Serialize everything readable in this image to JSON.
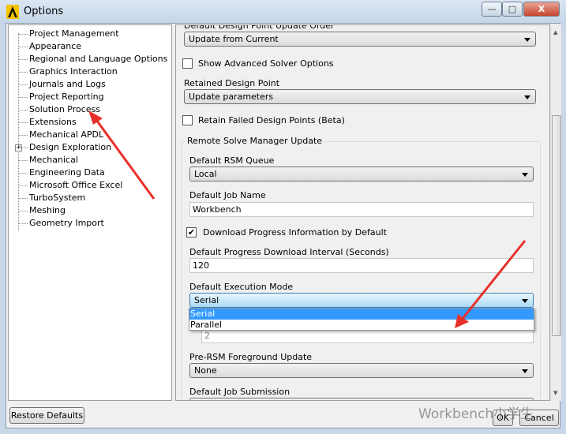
{
  "window": {
    "title": "Options",
    "minimize": "—",
    "maximize": "□",
    "close": "X"
  },
  "tree": {
    "items": [
      "Project Management",
      "Appearance",
      "Regional and Language Options",
      "Graphics Interaction",
      "Journals and Logs",
      "Project Reporting",
      "Solution Process",
      "Extensions",
      "Mechanical APDL",
      "Design Exploration",
      "Mechanical",
      "Engineering Data",
      "Microsoft Office Excel",
      "TurboSystem",
      "Meshing",
      "Geometry Import"
    ],
    "expandable": "Design Exploration",
    "expander": "+"
  },
  "panel": {
    "cut_label": "Default Design Point Update Order",
    "update_order": "Update from Current",
    "show_advanced": {
      "label": "Show Advanced Solver Options",
      "checked": false
    },
    "retained_label": "Retained Design Point",
    "retained_value": "Update parameters",
    "retain_failed": {
      "label": "Retain Failed Design Points (Beta)",
      "checked": false
    },
    "rsm_group": "Remote Solve Manager Update",
    "rsm_queue_label": "Default RSM Queue",
    "rsm_queue": "Local",
    "job_name_label": "Default Job Name",
    "job_name": "Workbench",
    "download_progress": {
      "label": "Download Progress Information by Default",
      "checked": true,
      "mark": "✔"
    },
    "interval_label": "Default Progress Download Interval (Seconds)",
    "interval": "120",
    "exec_mode_label": "Default Execution Mode",
    "exec_mode": "Serial",
    "exec_mode_options": [
      "Serial",
      "Parallel"
    ],
    "cores": "2",
    "pre_rsm_label": "Pre-RSM Foreground Update",
    "pre_rsm": "None",
    "job_submission_label": "Default Job Submission"
  },
  "buttons": {
    "restore": "Restore Defaults",
    "ok": "OK",
    "cancel": "Cancel"
  },
  "watermark": "Workbench小学生",
  "colors": {
    "highlight": "#3399ff",
    "annotation_arrow": "#e8302a"
  }
}
